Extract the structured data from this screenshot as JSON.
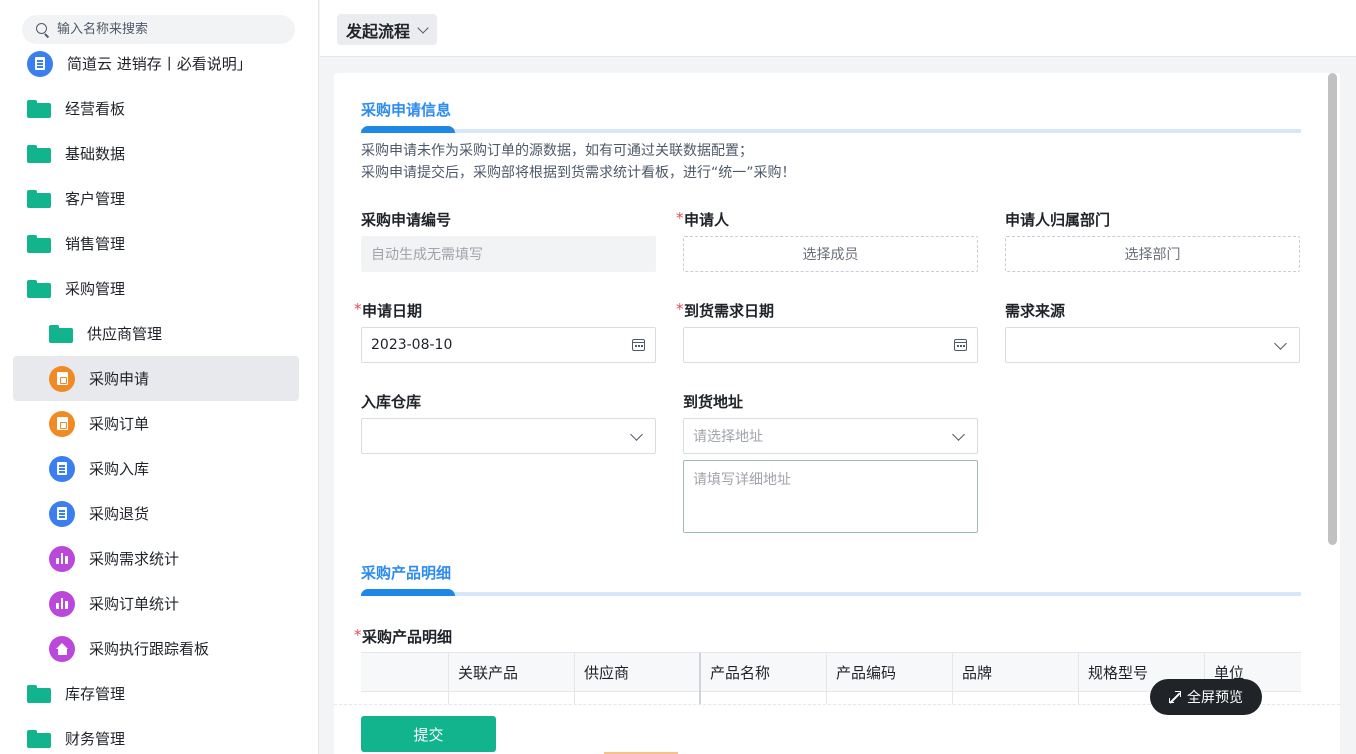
{
  "search": {
    "placeholder": "输入名称来搜索"
  },
  "sidebar": {
    "items": [
      {
        "label": "简道云 进销存丨必看说明」",
        "icon": "doc-icon",
        "level": "top"
      },
      {
        "label": "经营看板",
        "icon": "folder-icon",
        "level": "top"
      },
      {
        "label": "基础数据",
        "icon": "folder-icon",
        "level": "top"
      },
      {
        "label": "客户管理",
        "icon": "folder-icon",
        "level": "top"
      },
      {
        "label": "销售管理",
        "icon": "folder-icon",
        "level": "top"
      },
      {
        "label": "采购管理",
        "icon": "folder-open-icon",
        "level": "top"
      },
      {
        "label": "供应商管理",
        "icon": "folder-icon",
        "level": "sub"
      },
      {
        "label": "采购申请",
        "icon": "clipboard-icon",
        "level": "sub",
        "active": true
      },
      {
        "label": "采购订单",
        "icon": "clipboard-icon",
        "level": "sub"
      },
      {
        "label": "采购入库",
        "icon": "doc-icon",
        "level": "sub"
      },
      {
        "label": "采购退货",
        "icon": "doc-icon",
        "level": "sub"
      },
      {
        "label": "采购需求统计",
        "icon": "bar-chart-icon",
        "level": "sub"
      },
      {
        "label": "采购订单统计",
        "icon": "bar-chart-icon",
        "level": "sub"
      },
      {
        "label": "采购执行跟踪看板",
        "icon": "home-icon",
        "level": "sub"
      },
      {
        "label": "库存管理",
        "icon": "folder-icon",
        "level": "top"
      },
      {
        "label": "财务管理",
        "icon": "folder-icon",
        "level": "top"
      }
    ]
  },
  "topbar": {
    "flow_label": "发起流程"
  },
  "form": {
    "section1_title": "采购申请信息",
    "desc_line1": "采购申请未作为采购订单的源数据，如有可通过关联数据配置；",
    "desc_line2": "采购申请提交后，采购部将根据到货需求统计看板，进行“统一”采购！",
    "fields": {
      "req_no": {
        "label": "采购申请编号",
        "placeholder": "自动生成无需填写"
      },
      "applicant": {
        "label": "申请人",
        "required": "*",
        "placeholder": "选择成员"
      },
      "dept": {
        "label": "申请人归属部门",
        "placeholder": "选择部门"
      },
      "apply_date": {
        "label": "申请日期",
        "required": "*",
        "value": "2023-08-10"
      },
      "need_date": {
        "label": "到货需求日期",
        "required": "*",
        "value": ""
      },
      "source": {
        "label": "需求来源",
        "value": ""
      },
      "warehouse": {
        "label": "入库仓库",
        "value": ""
      },
      "address": {
        "label": "到货地址",
        "placeholder": "请选择地址",
        "detail_placeholder": "请填写详细地址"
      }
    },
    "section2_title": "采购产品明细",
    "table_label": "采购产品明细",
    "table_required": "*",
    "table_columns": [
      "关联产品",
      "供应商",
      "产品名称",
      "产品编码",
      "品牌",
      "规格型号",
      "单位"
    ]
  },
  "footer": {
    "submit_label": "提交",
    "fullscreen_label": "全屏预览"
  },
  "colors": {
    "accent_green": "#12b48e",
    "section_blue": "#2d8cf0"
  }
}
